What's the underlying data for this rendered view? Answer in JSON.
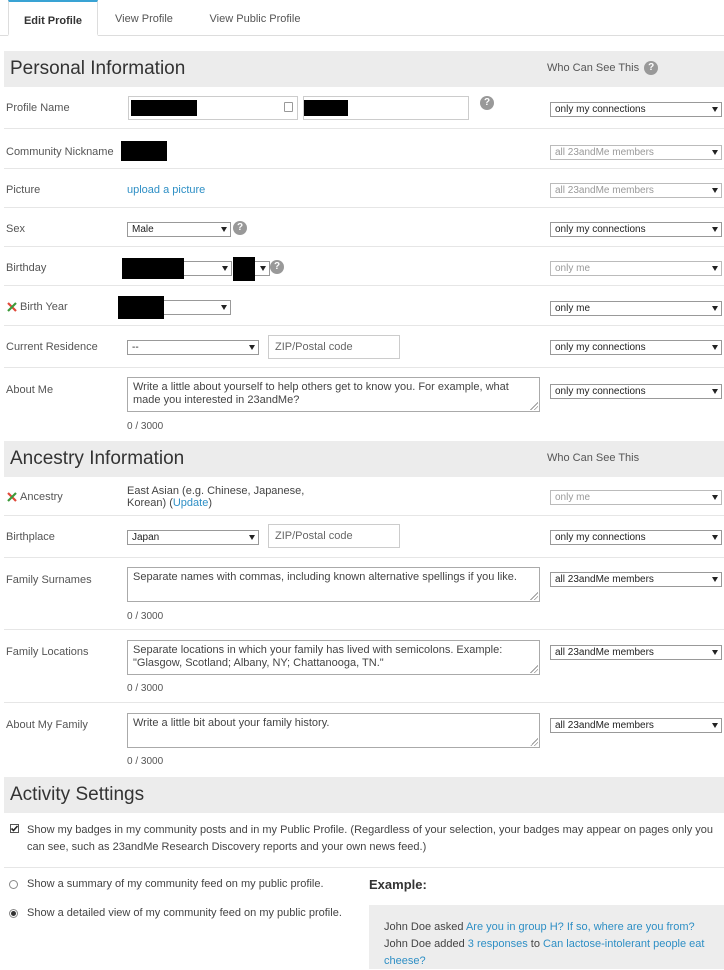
{
  "tabs": [
    {
      "label": "Edit Profile",
      "active": true
    },
    {
      "label": "View Profile"
    },
    {
      "label": "View Public Profile"
    }
  ],
  "personal": {
    "title": "Personal Information",
    "who_can_see": "Who Can See This",
    "profile_name": {
      "label": "Profile Name",
      "privacy": "only my connections"
    },
    "nickname": {
      "label": "Community Nickname",
      "privacy": "all 23andMe members"
    },
    "picture": {
      "label": "Picture",
      "link": "upload a picture",
      "privacy": "all 23andMe members"
    },
    "sex": {
      "label": "Sex",
      "value": "Male",
      "privacy": "only my connections"
    },
    "birthday": {
      "label": "Birthday",
      "privacy": "only me"
    },
    "birth_year": {
      "label": "Birth Year",
      "privacy": "only me"
    },
    "residence": {
      "label": "Current Residence",
      "country": "--",
      "zip_placeholder": "ZIP/Postal code",
      "privacy": "only my connections"
    },
    "about_me": {
      "label": "About Me",
      "placeholder": "Write a little about yourself to help others get to know you.  For example, what made you interested in 23andMe?",
      "counter": "0 / 3000",
      "privacy": "only my connections"
    }
  },
  "ancestry": {
    "title": "Ancestry Information",
    "who_can_see": "Who Can See This",
    "ancestry": {
      "label": "Ancestry",
      "value": "East Asian (e.g. Chinese, Japanese, Korean) (",
      "update_link": "Update",
      "value_end": ")",
      "privacy": "only me"
    },
    "birthplace": {
      "label": "Birthplace",
      "country": "Japan",
      "zip_placeholder": "ZIP/Postal code",
      "privacy": "only my connections"
    },
    "surnames": {
      "label": "Family Surnames",
      "placeholder": "Separate names with commas, including known alternative spellings if you like.",
      "counter": "0 / 3000",
      "privacy": "all 23andMe members"
    },
    "locations": {
      "label": "Family Locations",
      "placeholder": "Separate locations in which your family has lived with semicolons. Example: \"Glasgow, Scotland; Albany, NY; Chattanooga, TN.\"",
      "counter": "0 / 3000",
      "privacy": "all 23andMe members"
    },
    "family": {
      "label": "About My Family",
      "placeholder": "Write a little bit about your family history.",
      "counter": "0 / 3000",
      "privacy": "all 23andMe members"
    }
  },
  "activity": {
    "title": "Activity Settings",
    "badges_text": "Show my badges in my community posts and in my Public Profile. (Regardless of your selection, your badges may appear on pages only you can see, such as 23andMe Research Discovery reports and your own news feed.)",
    "badges_checked": true,
    "summary_option": "Show a summary of my community feed on my public profile.",
    "detailed_option": "Show a detailed view of my community feed on my public profile.",
    "selected_option": "detailed",
    "example_title": "Example:",
    "example": {
      "line1_prefix": "John Doe asked ",
      "line1_link": "Are you in group H? If so, where are you from?",
      "line2_prefix": "John Doe added ",
      "line2_link1": "3 responses",
      "line2_mid": " to ",
      "line2_link2": "Can lactose-intolerant people eat cheese?"
    }
  },
  "colors": {
    "accent": "#39a3d4",
    "link": "#2e8fc5",
    "section_bg": "#ececec"
  }
}
